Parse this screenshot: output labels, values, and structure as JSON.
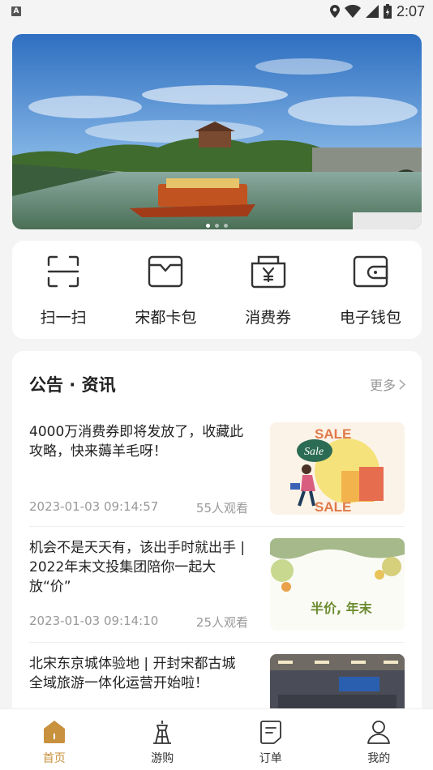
{
  "status_bar": {
    "time": "2:07",
    "notification_badge": "A"
  },
  "banner": {
    "slide_count": 3,
    "active_slide": 0
  },
  "quick_actions": [
    {
      "label": "扫一扫",
      "icon": "scan-icon"
    },
    {
      "label": "宋都卡包",
      "icon": "card-wallet-icon"
    },
    {
      "label": "消费券",
      "icon": "coupon-icon"
    },
    {
      "label": "电子钱包",
      "icon": "e-wallet-icon"
    }
  ],
  "news": {
    "title": "公告 · 资讯",
    "more_label": "更多",
    "items": [
      {
        "headline": "4000万消费券即将发放了，收藏此攻略，快来薅羊毛呀！",
        "date": "2023-01-03 09:14:57",
        "views": "55人观看",
        "thumb_text_top": "SALE",
        "thumb_bubble": "Sale",
        "thumb_text_bottom": "SALE"
      },
      {
        "headline": "机会不是天天有，该出手时就出手 | 2022年末文投集团陪你一起大放“价”",
        "date": "2023-01-03 09:14:10",
        "views": "25人观看",
        "thumb_text": "半价, 年末"
      },
      {
        "headline": "北宋东京城体验地 | 开封宋都古城全域旅游一体化运营开始啦！",
        "date": "",
        "views": ""
      }
    ]
  },
  "tabbar": {
    "tabs": [
      {
        "label": "首页",
        "icon": "home-icon",
        "active": true
      },
      {
        "label": "游购",
        "icon": "tower-icon",
        "active": false
      },
      {
        "label": "订单",
        "icon": "order-icon",
        "active": false
      },
      {
        "label": "我的",
        "icon": "profile-icon",
        "active": false
      }
    ]
  },
  "colors": {
    "accent": "#c8913e",
    "background": "#f4f4f4"
  }
}
